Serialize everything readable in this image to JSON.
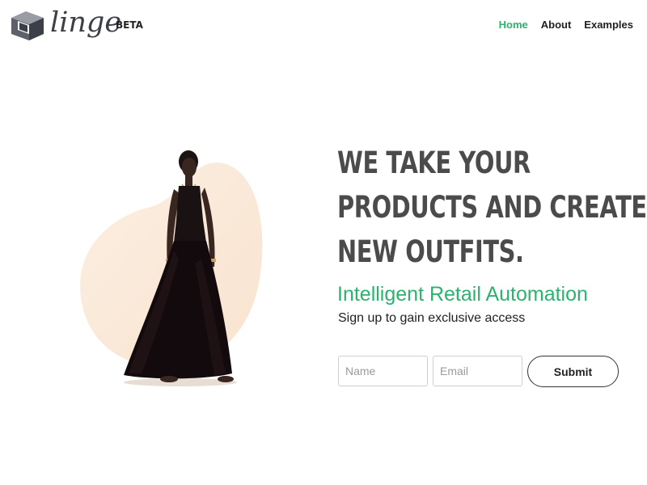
{
  "brand": {
    "name": "linge",
    "badge": "BETA"
  },
  "nav": {
    "items": [
      {
        "label": "Home",
        "active": true
      },
      {
        "label": "About",
        "active": false
      },
      {
        "label": "Examples",
        "active": false
      }
    ]
  },
  "hero": {
    "headline_lines": [
      "We take your",
      "products and create",
      "new outfits."
    ],
    "tagline": "Intelligent Retail Automation",
    "subtagline": "Sign up to gain exclusive access"
  },
  "form": {
    "name_placeholder": "Name",
    "name_value": "",
    "email_placeholder": "Email",
    "email_value": "",
    "submit_label": "Submit"
  },
  "colors": {
    "accent": "#2ab36e",
    "headline": "#4b4b4b",
    "blob": "#fbeadb",
    "logo": "#3c3f47"
  },
  "icons": {
    "logo": "stacked-blocks-icon"
  }
}
